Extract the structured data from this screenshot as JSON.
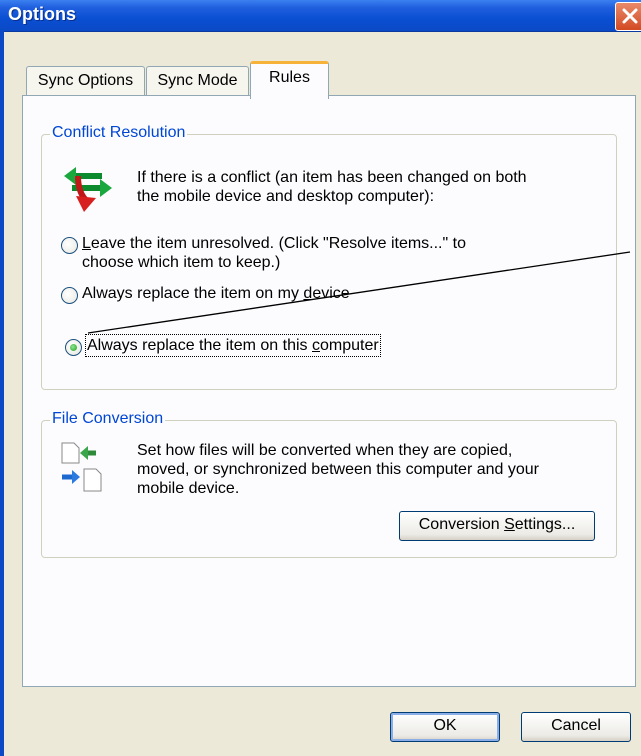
{
  "window": {
    "title": "Options"
  },
  "tabs": [
    {
      "label": "Sync Options"
    },
    {
      "label": "Sync Mode"
    },
    {
      "label": "Rules"
    }
  ],
  "conflict": {
    "label": "Conflict Resolution",
    "description_line1": "If there is a conflict (an item has been changed on both",
    "description_line2": "the mobile device and desktop computer):",
    "options": [
      {
        "pre": "",
        "key": "L",
        "post": "eave the item unresolved. (Click \"Resolve items...\" to",
        "line2": "choose which item to keep.)"
      },
      {
        "pre": "Always replace the item on my ",
        "key": "d",
        "post": "evice"
      },
      {
        "pre": "Always replace the item on this ",
        "key": "c",
        "post": "omputer"
      }
    ],
    "selected_index": 2
  },
  "file_conversion": {
    "label": "File Conversion",
    "line1": "Set how files will be converted when they are copied,",
    "line2": "moved, or synchronized between this computer and your",
    "line3": "mobile device.",
    "button_pre": "Conversion ",
    "button_key": "S",
    "button_post": "ettings..."
  },
  "buttons": {
    "ok": "OK",
    "cancel": "Cancel"
  },
  "icons": {
    "title_close": "close-icon",
    "conflict": "sync-conflict-arrows-icon",
    "conversion": "file-conversion-icon"
  },
  "colors": {
    "titlebar": "#0b49c6",
    "accent_label": "#0046d5",
    "close": "#d24a22"
  }
}
